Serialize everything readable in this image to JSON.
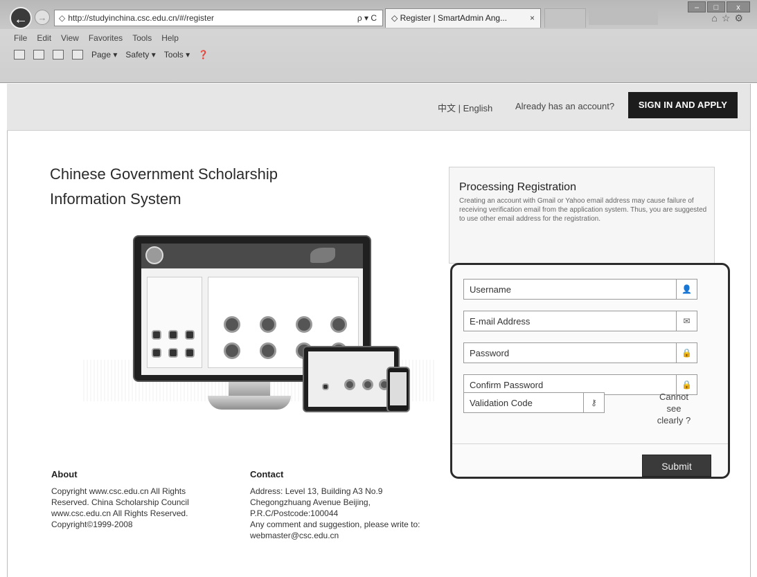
{
  "browser": {
    "url": "http://studyinchina.csc.edu.cn/#/register",
    "address_tools": "ρ ▾ C",
    "tab_title": "Register | SmartAdmin Ang...",
    "tab_close": "×",
    "menu": [
      "File",
      "Edit",
      "View",
      "Favorites",
      "Tools",
      "Help"
    ],
    "commands": [
      "Page ▾",
      "Safety ▾",
      "Tools ▾"
    ],
    "window_buttons": [
      "–",
      "□",
      "x"
    ],
    "toolbar_icons": [
      "home-icon",
      "star-icon",
      "gear-icon"
    ]
  },
  "topbar": {
    "lang_zh": "中文",
    "lang_sep": " | ",
    "lang_en": "English",
    "already": "Already has an account?",
    "signin": "SIGN IN AND APPLY"
  },
  "left": {
    "title_line1": "Chinese Government Scholarship",
    "title_line2": "Information System"
  },
  "panel": {
    "heading": "Processing Registration",
    "notice": "Creating an account with Gmail or Yahoo email address may cause failure of receiving verification email from the application system. Thus, you are suggested to use other email address for the registration."
  },
  "form": {
    "username_placeholder": "Username",
    "email_placeholder": "E-mail Address",
    "password_placeholder": "Password",
    "confirm_placeholder": "Confirm Password",
    "vcode_placeholder": "Validation Code",
    "cannot_see": "Cannot see clearly ?",
    "submit": "Submit",
    "icons": {
      "username": "user-icon",
      "email": "envelope-icon",
      "password": "lock-icon",
      "confirm": "lock-icon",
      "vcode": "key-icon"
    }
  },
  "footer": {
    "about_title": "About",
    "about_text": "Copyright www.csc.edu.cn All Rights Reserved. China Scholarship Council www.csc.edu.cn All Rights Reserved. Copyright©1999-2008",
    "contact_title": "Contact",
    "contact_address": "Address: Level 13, Building A3 No.9 Chegongzhuang Avenue Beijing, P.R.C/Postcode:100044",
    "contact_comment": "Any comment and suggestion, please write to: webmaster@csc.edu.cn"
  }
}
